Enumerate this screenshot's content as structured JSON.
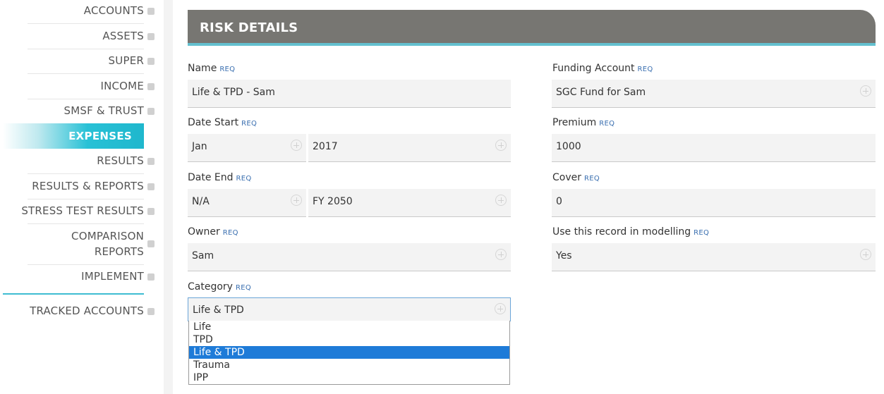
{
  "sidebar": {
    "items": [
      {
        "label": "ACCOUNTS"
      },
      {
        "label": "ASSETS"
      },
      {
        "label": "SUPER"
      },
      {
        "label": "INCOME"
      },
      {
        "label": "SMSF & TRUST"
      },
      {
        "label": "EXPENSES",
        "active": true
      },
      {
        "label": "RESULTS"
      },
      {
        "label": "RESULTS & REPORTS"
      },
      {
        "label": "STRESS TEST RESULTS"
      },
      {
        "label_line1": "COMPARISON",
        "label_line2": "REPORTS"
      },
      {
        "label": "IMPLEMENT"
      },
      {
        "label": "TRACKED ACCOUNTS"
      }
    ]
  },
  "header": {
    "title": "RISK DETAILS"
  },
  "req_tag": "REQ",
  "form": {
    "name": {
      "label": "Name",
      "value": "Life & TPD - Sam"
    },
    "date_start": {
      "label": "Date Start",
      "month": "Jan",
      "year": "2017"
    },
    "date_end": {
      "label": "Date End",
      "month": "N/A",
      "year": "FY 2050"
    },
    "owner": {
      "label": "Owner",
      "value": "Sam"
    },
    "category": {
      "label": "Category",
      "value": "Life & TPD",
      "options": [
        "Life",
        "TPD",
        "Life & TPD",
        "Trauma",
        "IPP"
      ],
      "selected_index": 2
    },
    "funding_account": {
      "label": "Funding Account",
      "value": "SGC Fund for Sam"
    },
    "premium": {
      "label": "Premium",
      "value": "1000"
    },
    "cover": {
      "label": "Cover",
      "value": "0"
    },
    "use_in_modelling": {
      "label": "Use this record in modelling",
      "value": "Yes"
    }
  },
  "colors": {
    "accent": "#1fb7cd",
    "header_bg": "#777672",
    "header_line": "#63c0cf",
    "select_highlight": "#1e7bd8",
    "req": "#3a6fb0"
  }
}
